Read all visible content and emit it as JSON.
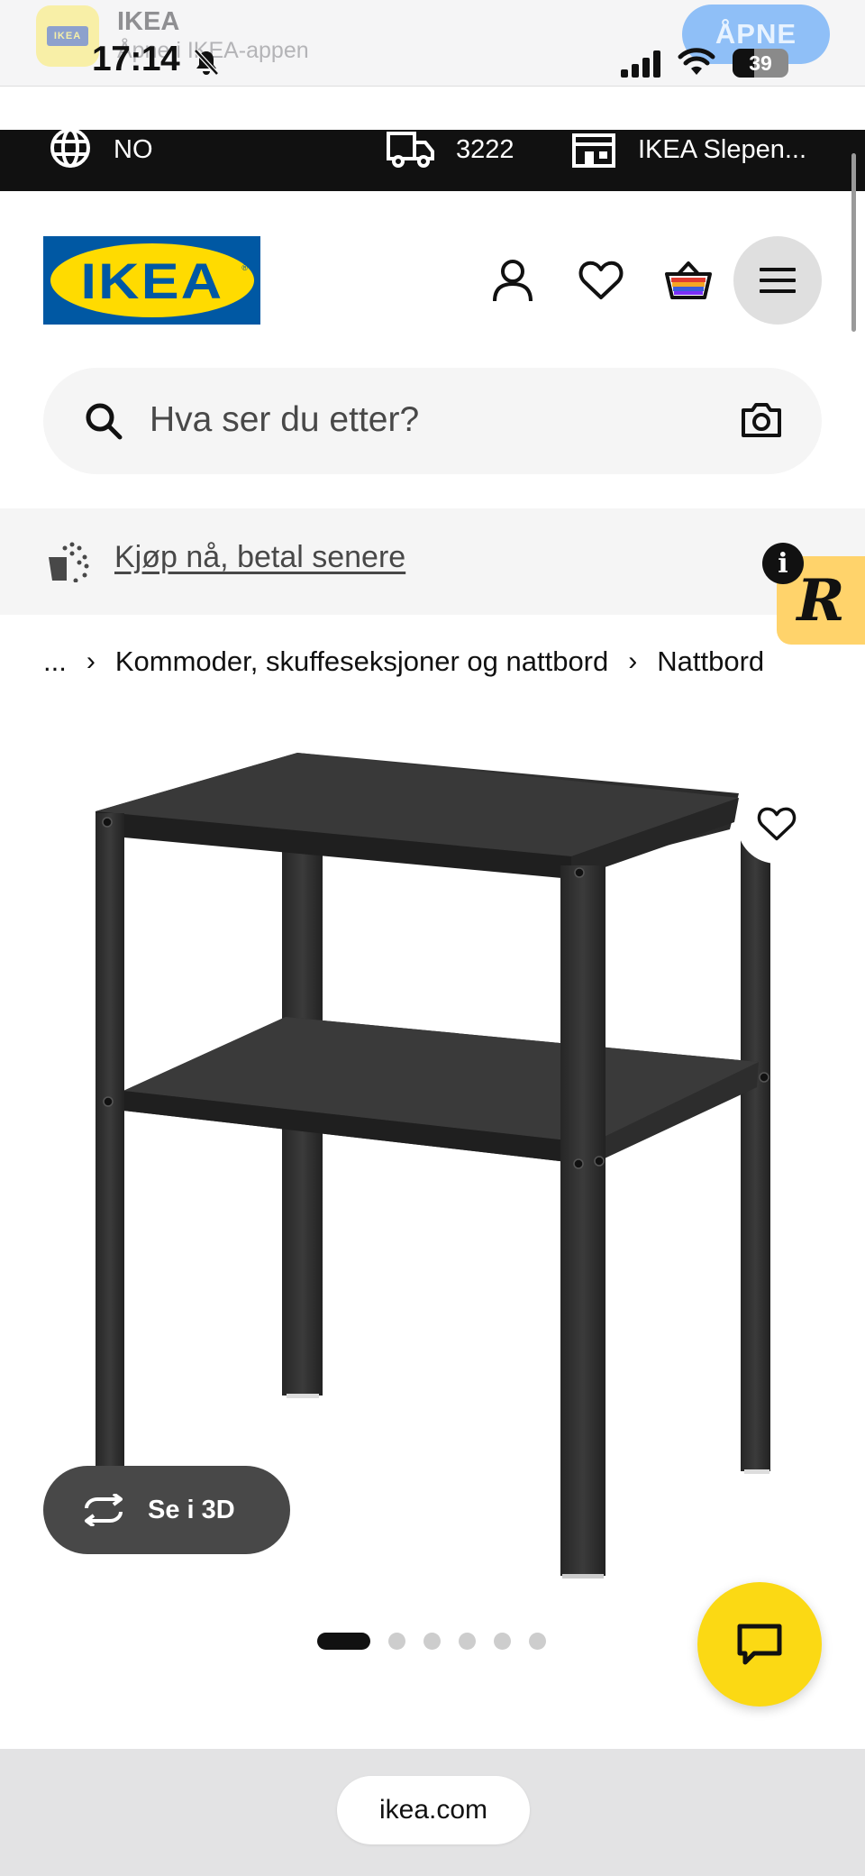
{
  "app_banner": {
    "app_name": "IKEA",
    "subtitle": "Åpne i IKEA-appen",
    "open_label": "ÅPNE",
    "icon_logo_text": "IKEA"
  },
  "status_bar": {
    "time": "17:14",
    "battery": "39"
  },
  "topbar": {
    "language": "NO",
    "postcode": "3222",
    "store": "IKEA Slepen..."
  },
  "header": {
    "logo_text": "IKEA"
  },
  "search": {
    "placeholder": "Hva ser du etter?"
  },
  "pay_later": {
    "text": "Kjøp nå, betal senere"
  },
  "widget": {
    "letter": "R",
    "info": "i"
  },
  "breadcrumb": {
    "items": [
      "...",
      "Kommoder, skuffeseksjoner og nattbord",
      "Nattbord"
    ]
  },
  "product": {
    "view_3d_label": "Se i 3D",
    "image_count": 6,
    "active_image": 1
  },
  "browser": {
    "url": "ikea.com"
  },
  "colors": {
    "brand_blue": "#0058a3",
    "brand_yellow": "#ffdb00",
    "chat_yellow": "#fbd914",
    "dark": "#111111"
  }
}
